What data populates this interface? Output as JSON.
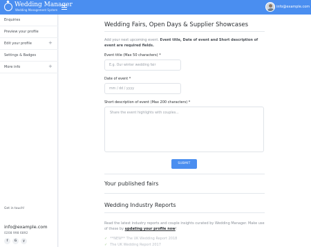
{
  "header": {
    "brand_name": "Wedding Manager",
    "brand_tagline": "Wedding Management System",
    "user_email": "info@example.com"
  },
  "sidebar": {
    "items": [
      {
        "label": "Enquiries",
        "expandable": false
      },
      {
        "label": "Preview your profile",
        "expandable": false
      },
      {
        "label": "Edit your profile",
        "expandable": true
      },
      {
        "label": "Settings & Badges",
        "expandable": false
      },
      {
        "label": "More info",
        "expandable": true
      }
    ],
    "footer": {
      "get_in_touch": "Get in touch!",
      "email": "info@example.com",
      "phone": "0208 998 6892",
      "social": [
        {
          "icon": "facebook-icon",
          "glyph": "f"
        },
        {
          "icon": "google-icon",
          "glyph": "G"
        },
        {
          "icon": "twitter-icon",
          "glyph": "y"
        }
      ]
    }
  },
  "main": {
    "title": "Wedding Fairs, Open Days & Supplier Showcases",
    "intro_plain": "Add your next upcoming event.",
    "intro_bold": "Event title, Date of event and Short description of event are required fields.",
    "form": {
      "title_label": "Event title (Max 50 characters) *",
      "title_placeholder": "E.g. Our winter wedding fair",
      "date_label": "Date of event *",
      "date_placeholder": "mm / dd / yyyy",
      "desc_label": "Short description of event (Max 200 characters) *",
      "desc_placeholder": "Share the event highlights with couples...",
      "submit_label": "SUBMIT"
    },
    "published_title": "Your published fairs",
    "reports_title": "Wedding Industry Reports",
    "reports_text": "Read the latest industry reports and couple insights curated by Wedding Manager. Make use of these by",
    "reports_link": "updating your profile now",
    "reports_link_suffix": "!",
    "reports_items": [
      "**NEW** The UK Wedding Report 2018",
      "The UK Wedding Report 2017"
    ]
  },
  "colors": {
    "accent": "#4a8ef0",
    "sidebar_bg": "#ffffff",
    "page_bg": "#f3f5f8"
  }
}
